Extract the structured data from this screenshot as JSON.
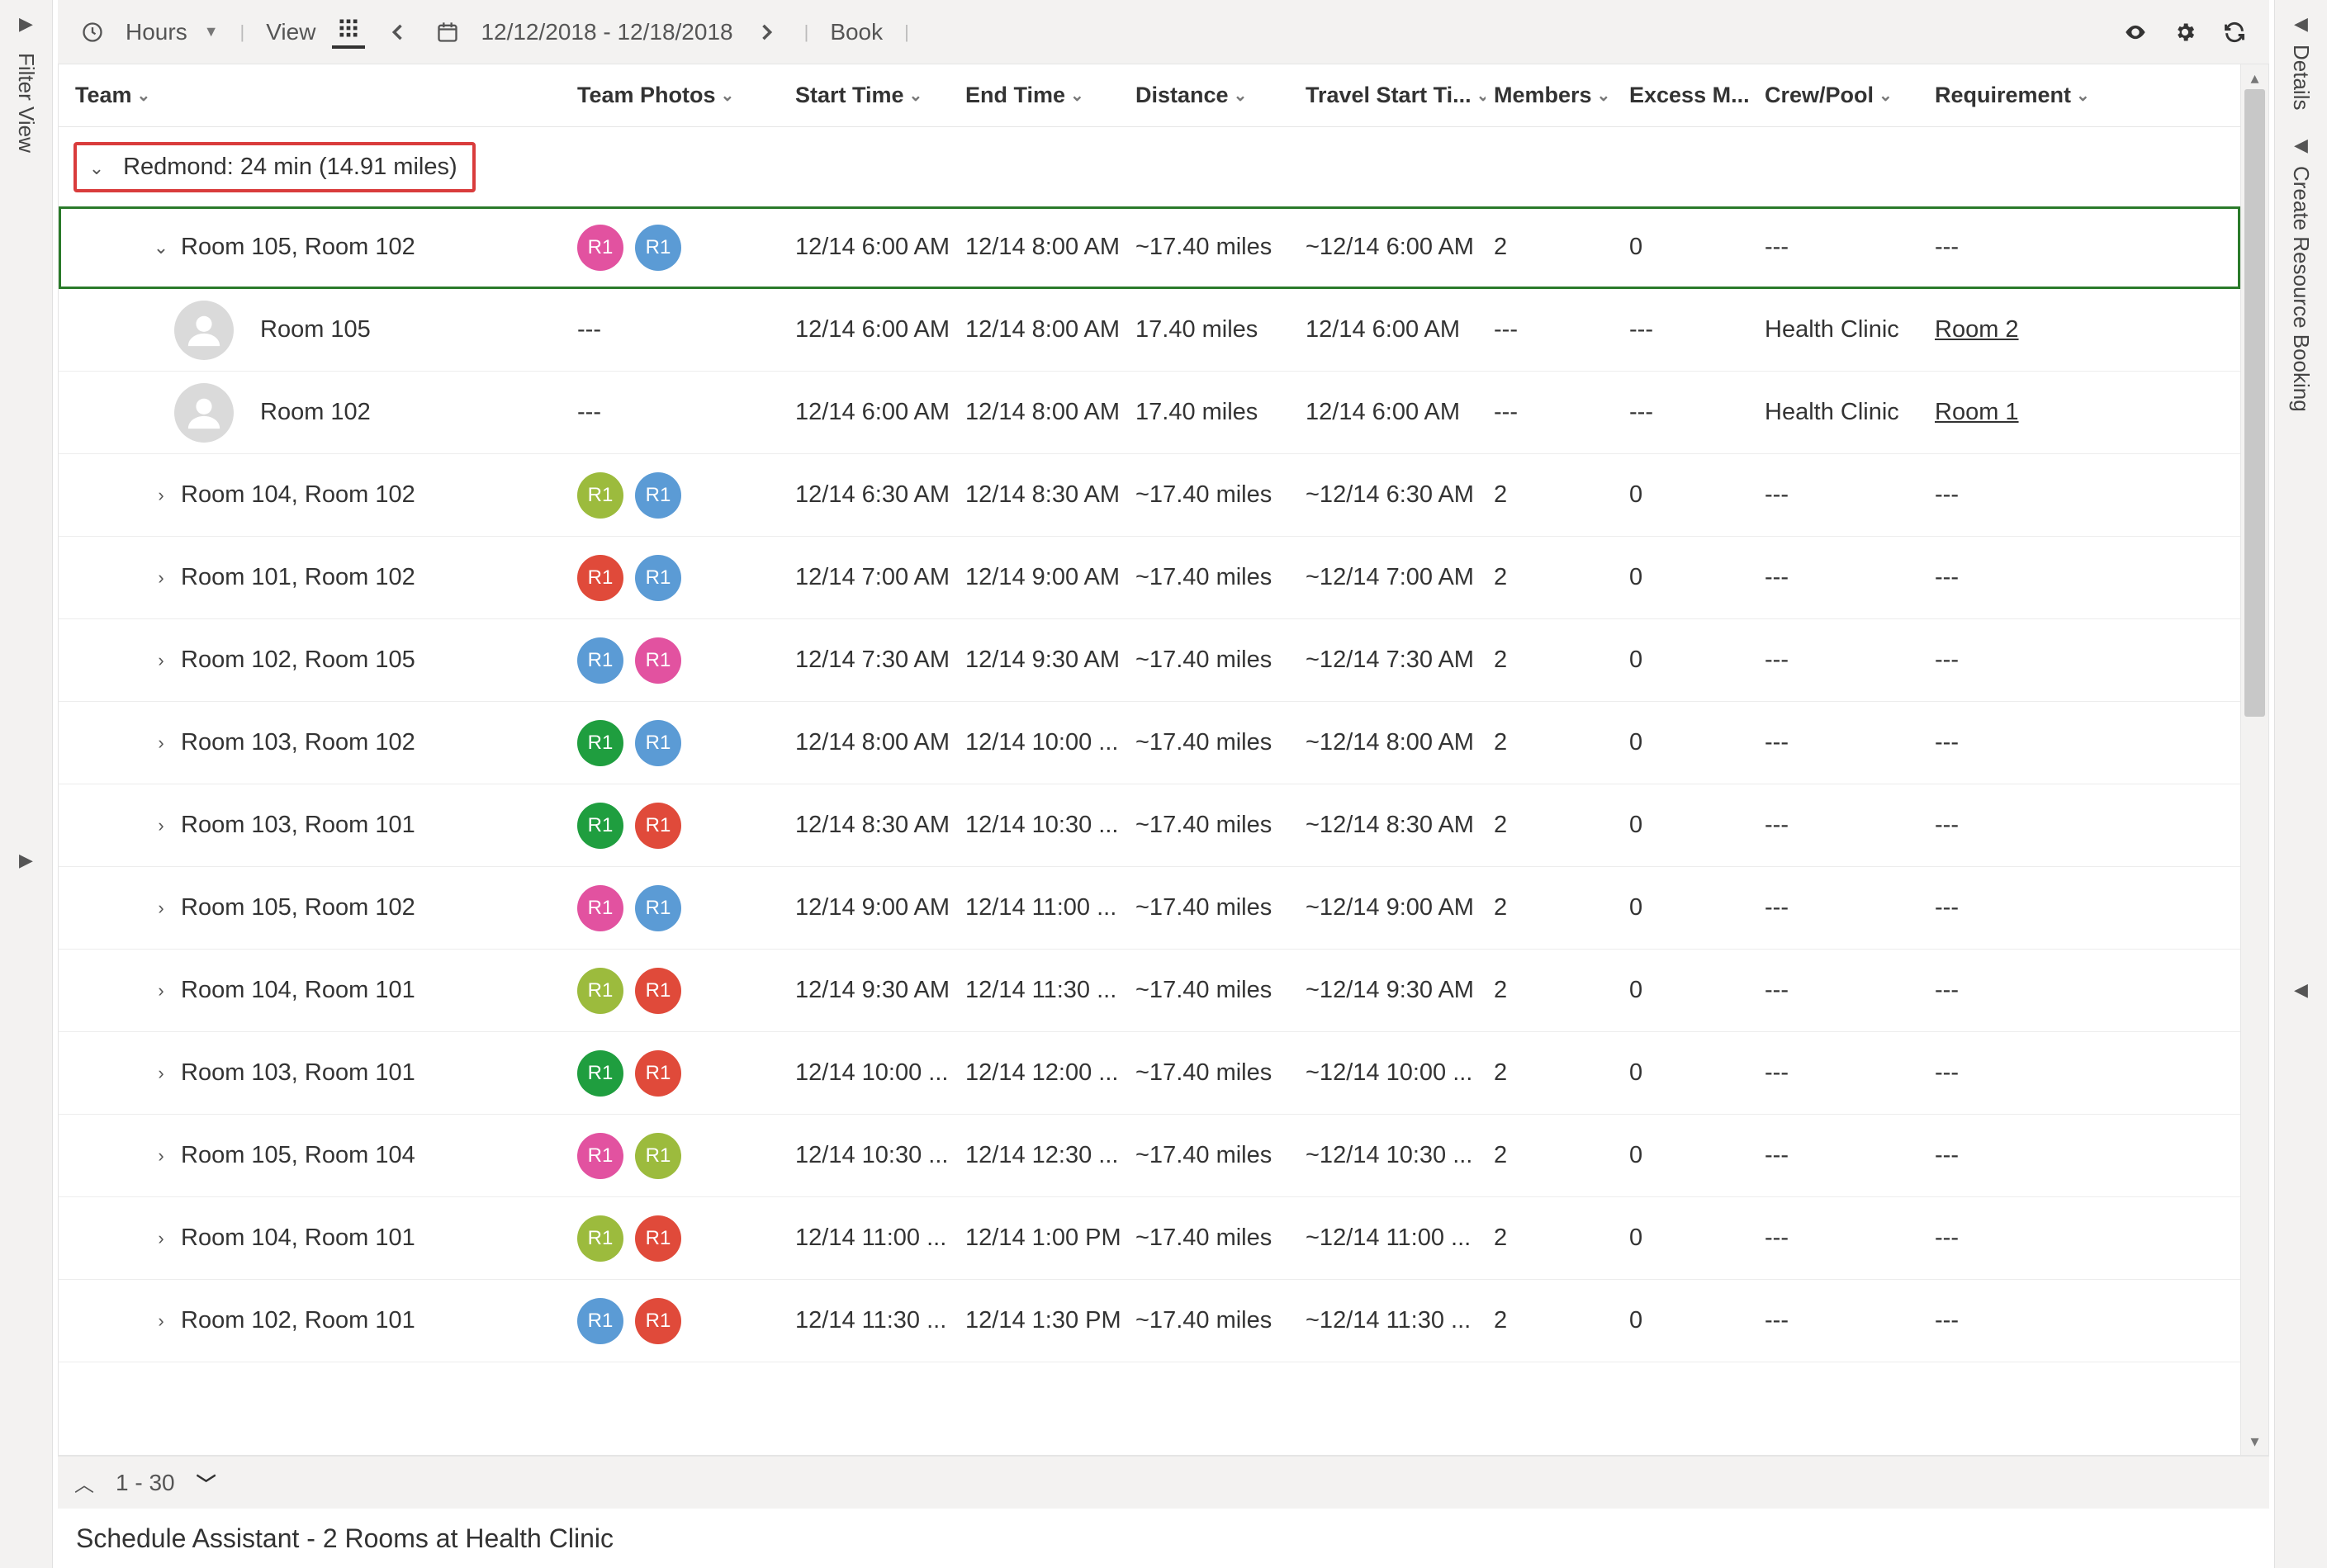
{
  "leftRail": {
    "label": "Filter View"
  },
  "rightRail": {
    "label1": "Details",
    "label2": "Create Resource Booking"
  },
  "toolbar": {
    "hours": "Hours",
    "view": "View",
    "dateRange": "12/12/2018 - 12/18/2018",
    "book": "Book"
  },
  "columns": {
    "team": "Team",
    "photos": "Team Photos",
    "start": "Start Time",
    "end": "End Time",
    "dist": "Distance",
    "trav": "Travel Start Ti...",
    "mem": "Members",
    "ex": "Excess M...",
    "crew": "Crew/Pool",
    "req": "Requirement"
  },
  "group": {
    "label": "Redmond: 24 min (14.91 miles)"
  },
  "colors": {
    "pink": "#e252a0",
    "blue": "#5b9bd5",
    "olive": "#9cbb3d",
    "red": "#e04a3a",
    "green": "#1f9e3f"
  },
  "children": [
    {
      "name": "Room 105",
      "start": "12/14 6:00 AM",
      "end": "12/14 8:00 AM",
      "dist": "17.40 miles",
      "trav": "12/14 6:00 AM",
      "mem": "---",
      "ex": "---",
      "crew": "Health Clinic",
      "req": "Room 2"
    },
    {
      "name": "Room 102",
      "start": "12/14 6:00 AM",
      "end": "12/14 8:00 AM",
      "dist": "17.40 miles",
      "trav": "12/14 6:00 AM",
      "mem": "---",
      "ex": "---",
      "crew": "Health Clinic",
      "req": "Room 1"
    }
  ],
  "rows": [
    {
      "team": "Room 105, Room 102",
      "c1": "pink",
      "c2": "blue",
      "start": "12/14 6:00 AM",
      "end": "12/14 8:00 AM",
      "dist": "~17.40 miles",
      "trav": "~12/14 6:00 AM",
      "mem": "2",
      "ex": "0",
      "crew": "---",
      "req": "---",
      "sel": true,
      "open": true
    },
    {
      "team": "Room 104, Room 102",
      "c1": "olive",
      "c2": "blue",
      "start": "12/14 6:30 AM",
      "end": "12/14 8:30 AM",
      "dist": "~17.40 miles",
      "trav": "~12/14 6:30 AM",
      "mem": "2",
      "ex": "0",
      "crew": "---",
      "req": "---"
    },
    {
      "team": "Room 101, Room 102",
      "c1": "red",
      "c2": "blue",
      "start": "12/14 7:00 AM",
      "end": "12/14 9:00 AM",
      "dist": "~17.40 miles",
      "trav": "~12/14 7:00 AM",
      "mem": "2",
      "ex": "0",
      "crew": "---",
      "req": "---"
    },
    {
      "team": "Room 102, Room 105",
      "c1": "blue",
      "c2": "pink",
      "start": "12/14 7:30 AM",
      "end": "12/14 9:30 AM",
      "dist": "~17.40 miles",
      "trav": "~12/14 7:30 AM",
      "mem": "2",
      "ex": "0",
      "crew": "---",
      "req": "---"
    },
    {
      "team": "Room 103, Room 102",
      "c1": "green",
      "c2": "blue",
      "start": "12/14 8:00 AM",
      "end": "12/14 10:00 ...",
      "dist": "~17.40 miles",
      "trav": "~12/14 8:00 AM",
      "mem": "2",
      "ex": "0",
      "crew": "---",
      "req": "---"
    },
    {
      "team": "Room 103, Room 101",
      "c1": "green",
      "c2": "red",
      "start": "12/14 8:30 AM",
      "end": "12/14 10:30 ...",
      "dist": "~17.40 miles",
      "trav": "~12/14 8:30 AM",
      "mem": "2",
      "ex": "0",
      "crew": "---",
      "req": "---"
    },
    {
      "team": "Room 105, Room 102",
      "c1": "pink",
      "c2": "blue",
      "start": "12/14 9:00 AM",
      "end": "12/14 11:00 ...",
      "dist": "~17.40 miles",
      "trav": "~12/14 9:00 AM",
      "mem": "2",
      "ex": "0",
      "crew": "---",
      "req": "---"
    },
    {
      "team": "Room 104, Room 101",
      "c1": "olive",
      "c2": "red",
      "start": "12/14 9:30 AM",
      "end": "12/14 11:30 ...",
      "dist": "~17.40 miles",
      "trav": "~12/14 9:30 AM",
      "mem": "2",
      "ex": "0",
      "crew": "---",
      "req": "---"
    },
    {
      "team": "Room 103, Room 101",
      "c1": "green",
      "c2": "red",
      "start": "12/14 10:00 ...",
      "end": "12/14 12:00 ...",
      "dist": "~17.40 miles",
      "trav": "~12/14 10:00 ...",
      "mem": "2",
      "ex": "0",
      "crew": "---",
      "req": "---"
    },
    {
      "team": "Room 105, Room 104",
      "c1": "pink",
      "c2": "olive",
      "start": "12/14 10:30 ...",
      "end": "12/14 12:30 ...",
      "dist": "~17.40 miles",
      "trav": "~12/14 10:30 ...",
      "mem": "2",
      "ex": "0",
      "crew": "---",
      "req": "---"
    },
    {
      "team": "Room 104, Room 101",
      "c1": "olive",
      "c2": "red",
      "start": "12/14 11:00 ...",
      "end": "12/14 1:00 PM",
      "dist": "~17.40 miles",
      "trav": "~12/14 11:00 ...",
      "mem": "2",
      "ex": "0",
      "crew": "---",
      "req": "---"
    },
    {
      "team": "Room 102, Room 101",
      "c1": "blue",
      "c2": "red",
      "start": "12/14 11:30 ...",
      "end": "12/14 1:30 PM",
      "dist": "~17.40 miles",
      "trav": "~12/14 11:30 ...",
      "mem": "2",
      "ex": "0",
      "crew": "---",
      "req": "---"
    }
  ],
  "pager": {
    "range": "1 - 30"
  },
  "footer": {
    "title": "Schedule Assistant - 2 Rooms at Health Clinic"
  }
}
